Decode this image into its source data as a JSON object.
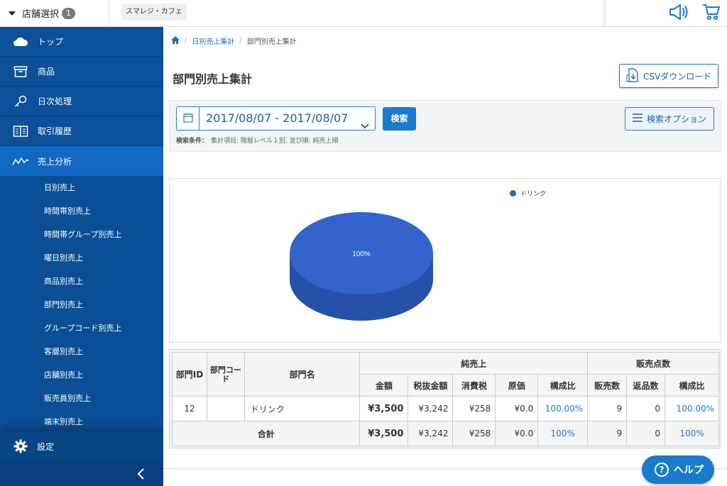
{
  "topbar": {
    "store_select_label": "店舗選択",
    "store_count": "1",
    "store_name": "スマレジ・カフェ"
  },
  "sidebar": {
    "items": [
      {
        "label": "トップ",
        "icon": "cloud-icon"
      },
      {
        "label": "商品",
        "icon": "box-icon"
      },
      {
        "label": "日次処理",
        "icon": "key-icon"
      },
      {
        "label": "取引履歴",
        "icon": "book-icon"
      },
      {
        "label": "売上分析",
        "icon": "chart-line-icon",
        "active": true
      }
    ],
    "subitems": [
      "日別売上",
      "時間帯別売上",
      "時間帯グループ別売上",
      "曜日別売上",
      "商品別売上",
      "部門別売上",
      "グループコード別売上",
      "客層別売上",
      "店舗別売上",
      "販売員別売上",
      "端末別売上"
    ],
    "settings_label": "設定"
  },
  "breadcrumb": {
    "home_icon": "home-icon",
    "link": "日別売上集計",
    "current": "部門別売上集計"
  },
  "page": {
    "title": "部門別売上集計",
    "csv_button": "CSVダウンロード"
  },
  "search": {
    "date_range": "2017/08/07 - 2017/08/07",
    "search_button": "検索",
    "options_button": "検索オプション",
    "conditions_label": "検索条件：",
    "conditions_text": "集計項目: 階層レベル１別, 並び順: 純売上順"
  },
  "chart_data": {
    "type": "pie",
    "categories": [
      "ドリンク"
    ],
    "values": [
      100
    ],
    "data_labels": [
      "100%"
    ],
    "legend": [
      "ドリンク"
    ],
    "legend_position": "top-right",
    "colors": [
      "#3264cc"
    ],
    "three_d": true
  },
  "table": {
    "headers": {
      "dept_id": "部門ID",
      "dept_code": "部門コード",
      "dept_name": "部門名",
      "net_sales": "純売上",
      "amount": "金額",
      "pre_tax": "税抜金額",
      "tax": "消費税",
      "cost": "原価",
      "ratio": "構成比",
      "qty_group": "販売点数",
      "sold": "販売数",
      "returned": "返品数",
      "qty_ratio": "構成比"
    },
    "rows": [
      {
        "dept_id": "12",
        "dept_code": "",
        "dept_name": "ドリンク",
        "amount": "¥3,500",
        "pre_tax": "¥3,242",
        "tax": "¥258",
        "cost": "¥0.0",
        "ratio": "100.00%",
        "sold": "9",
        "returned": "0",
        "qty_ratio": "100.00%"
      }
    ],
    "total": {
      "label": "合計",
      "amount": "¥3,500",
      "pre_tax": "¥3,242",
      "tax": "¥258",
      "cost": "¥0.0",
      "ratio": "100%",
      "sold": "9",
      "returned": "0",
      "qty_ratio": "100%"
    }
  },
  "help": {
    "label": "ヘルプ",
    "icon_glyph": "?"
  },
  "colors": {
    "sidebar": "#0a4f96",
    "sidebar_active": "#1169c4",
    "accent": "#1a7acc",
    "pie": "#3264cc"
  }
}
